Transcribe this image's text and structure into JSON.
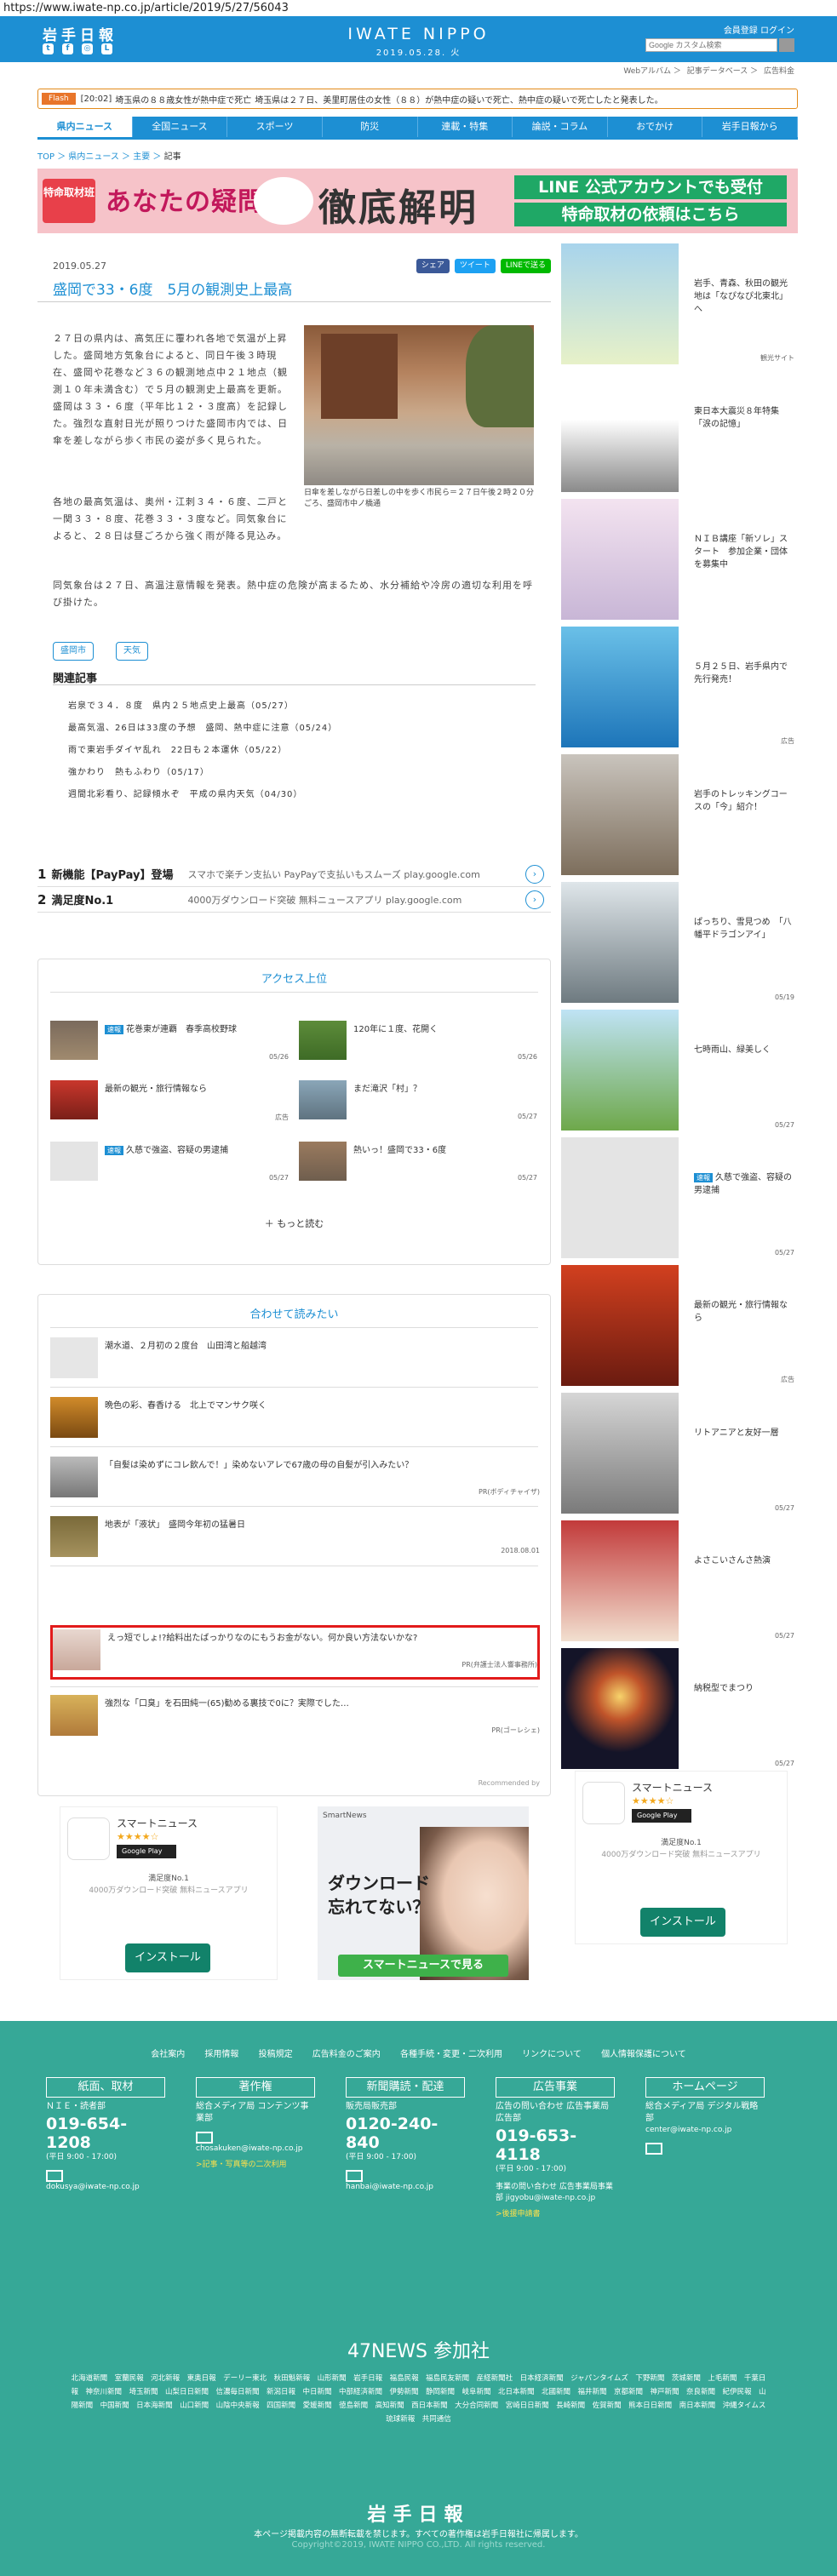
{
  "browser": {
    "url": "https://www.iwate-np.co.jp/article/2019/5/27/56043"
  },
  "header": {
    "logo_jp": "岩手日報",
    "logo_en": "IWATE NIPPO",
    "date": "2019.05.28. 火",
    "member_links": "会員登録 ログイン",
    "search_placeholder": "Google カスタム検索",
    "subnav": [
      "Webアルバム",
      "記事データベース",
      "広告料金"
    ]
  },
  "flash": {
    "tag": "Flash",
    "time": "[20:02]",
    "headline": "埼玉県の８８歳女性が熱中症で死亡",
    "text": "埼玉県は２７日、美里町居住の女性（８８）が熱中症の疑いで死亡、熱中症の疑いで死亡したと発表した。"
  },
  "gnav": [
    "県内ニュース",
    "全国ニュース",
    "スポーツ",
    "防災",
    "連載・特集",
    "論説・コラム",
    "おでかけ",
    "岩手日報から"
  ],
  "breadcrumb": {
    "top": "TOP",
    "cat": "県内ニュース",
    "sub": "主要",
    "current": "記事"
  },
  "banner": {
    "badge": "特命取材班",
    "lead": "あなたの疑問",
    "main": "徹底解明",
    "line1": "LINE 公式アカウントでも受付",
    "line2": "特命取材の依頼はこちら"
  },
  "article": {
    "date": "2019.05.27",
    "share": [
      "シェア",
      "ツイート",
      "LINEで送る"
    ],
    "title": "盛岡で33・6度　5月の観測史上最高",
    "p1": "２７日の県内は、高気圧に覆われ各地で気温が上昇した。盛岡地方気象台によると、同日午後３時現在、盛岡や花巻など３６の観測地点中２１地点（観測１０年未満含む）で５月の観測史上最高を更新。盛岡は３３・６度（平年比１２・３度高）を記録した。強烈な直射日光が照りつけた盛岡市内では、日傘を差しながら歩く市民の姿が多く見られた。",
    "p2": "各地の最高気温は、奥州・江刺３４・６度、二戸と一関３３・８度、花巻３３・３度など。同気象台によると、２８日は昼ごろから強く雨が降る見込み。",
    "p3": "同気象台は２７日、高温注意情報を発表。熱中症の危険が高まるため、水分補給や冷房の適切な利用を呼び掛けた。",
    "caption": "日傘を差しながら日差しの中を歩く市民ら＝２７日午後２時２０分ごろ、盛岡市中ノ橋通",
    "tags": [
      "盛岡市",
      "天気"
    ],
    "related_heading": "関連記事",
    "related": [
      "岩泉で３４．８度　県内２５地点史上最高（05/27）",
      "最高気温、26日は33度の予想　盛岡、熱中症に注意（05/24）",
      "雨で東岩手ダイヤ乱れ　22日も２本運休（05/22）",
      "強かわり　熱もふわり（05/17）",
      "週間北彩看り、記録傾水ぞ　平成の県内天気（04/30）"
    ]
  },
  "sponsored": [
    {
      "num": "1",
      "title": "新機能【PayPay】登場",
      "desc": "スマホで楽チン支払い PayPayで支払いもスムーズ play.google.com"
    },
    {
      "num": "2",
      "title": "満足度No.1",
      "desc": "4000万ダウンロード突破 無料ニュースアプリ play.google.com"
    }
  ],
  "access": {
    "heading": "アクセス上位",
    "items": [
      {
        "badge": "速報",
        "text": "花巻東が連覇　春季高校野球",
        "meta": "05/26"
      },
      {
        "badge": "",
        "text": "120年に１度、花開く",
        "meta": "05/26"
      },
      {
        "badge": "",
        "text": "最新の観光・旅行情報なら",
        "meta": "広告"
      },
      {
        "badge": "",
        "text": "まだ滝沢「村」？",
        "meta": "05/27"
      },
      {
        "badge": "速報",
        "text": "久慈で強盗、容疑の男逮捕",
        "meta": "05/27"
      },
      {
        "badge": "",
        "text": "熱いっ！盛岡で33・6度",
        "meta": "05/27"
      }
    ],
    "more": "もっと読む"
  },
  "recommend": {
    "heading": "合わせて読みたい",
    "items": [
      {
        "text": "潮水道、２月初の２度台　山田湾と船越湾",
        "meta": ""
      },
      {
        "text": "晩色の彩、春香ける　北上でマンサク咲く",
        "meta": ""
      },
      {
        "text": "「自髪は染めずにコレ飲んで！」染めないアレで67歳の母の自髪が引入みたい？",
        "meta": "PR(ボディチャイザ)"
      },
      {
        "text": "地表が「液状」　盛岡今年初の猛暑日",
        "meta": "2018.08.01"
      },
      {
        "text": "えっ短でしょ!?給料出たばっかりなのにもうお金がない。何か良い方法ないかな?",
        "meta": "PR(弁護士法人響事務所)"
      },
      {
        "text": "強烈な「口臭」を石田純一(65)勧める裏技で0に？実際でした…",
        "meta": "PR(ゴーレシェ)"
      }
    ],
    "recommended_by": "Recommended by"
  },
  "smartnews_ad": {
    "name": "スマートニュース",
    "stars": "★★★★☆",
    "gp": "Google Play",
    "rate": "満足度No.1",
    "desc": "4000万ダウンロード突破 無料ニュースアプリ",
    "install": "インストール"
  },
  "image_ad": {
    "brand": "SmartNews",
    "line1": "ダウンロード",
    "line2": "忘れてない？",
    "cta": "スマートニュースで見る"
  },
  "sidebar": [
    {
      "text": "岩手、青森、秋田の観光地は「なぴなぴ北東北」へ",
      "meta": "観光サイト"
    },
    {
      "text": "東日本大震災８年特集「涙の記憶」",
      "meta": ""
    },
    {
      "text": "ＮＩＢ講座「新ソレ」スタート　参加企業・団体を募集中",
      "meta": ""
    },
    {
      "text": "５月２５日、岩手県内で先行発売！",
      "meta": "広告"
    },
    {
      "text": "岩手のトレッキングコースの「今」紹介！",
      "meta": ""
    },
    {
      "text": "ぱっちり、雪見つめ　「八幡平ドラゴンアイ」",
      "meta": "05/19"
    },
    {
      "text": "七時雨山、緑美しく",
      "meta": "05/27"
    },
    {
      "text": "久慈で強盗、容疑の男逮捕",
      "badge": "速報",
      "meta": "05/27"
    },
    {
      "text": "最新の観光・旅行情報なら",
      "meta": "広告"
    },
    {
      "text": "リトアニアと友好一層",
      "meta": "05/27"
    },
    {
      "text": "よさこいさんさ熱演",
      "meta": "05/27"
    },
    {
      "text": "納税型でまつり",
      "meta": "05/27"
    }
  ],
  "footer": {
    "links": [
      "会社案内",
      "採用情報",
      "投稿規定",
      "広告料金のご案内",
      "各種手続・変更・二次利用",
      "リンクについて",
      "個人情報保護について"
    ],
    "cols": [
      {
        "head": "紙面、取材",
        "label": "ＮＩＥ・読者部",
        "phone": "019-654-1208",
        "hours": "(平日 9:00 - 17:00)",
        "email": "dokusya@iwate-np.co.jp",
        "extra": ""
      },
      {
        "head": "著作権",
        "label": "総合メディア局 コンテンツ事業部",
        "phone": "",
        "hours": "",
        "email": "chosakuken@iwate-np.co.jp",
        "extra": ">記事・写真等の二次利用"
      },
      {
        "head": "新聞購読・配達",
        "label": "販売局販売部",
        "phone": "0120-240-840",
        "hours": "(平日 9:00 - 17:00)",
        "email": "hanbai@iwate-np.co.jp",
        "extra": ""
      },
      {
        "head": "広告事業",
        "label": "広告の問い合わせ 広告事業局広告部",
        "phone": "019-653-4118",
        "hours": "(平日 9:00 - 17:00)",
        "email": "事業の問い合わせ 広告事業局事業部 jigyobu@iwate-np.co.jp",
        "extra": ">後援申請書"
      },
      {
        "head": "ホームページ",
        "label": "総合メディア局 デジタル戦略部",
        "phone": "",
        "hours": "",
        "email": "center@iwate-np.co.jp",
        "extra": ""
      }
    ],
    "n47_heading": "47NEWS 参加社",
    "n47_list": "北海道新聞　室蘭民報　河北新報　東奥日報　デーリー東北　秋田魁新報　山形新聞　岩手日報　福島民報　福島民友新聞　産経新聞社　日本経済新聞　ジャパンタイムズ　下野新聞　茨城新聞　上毛新聞　千葉日報　神奈川新聞　埼玉新聞　山梨日日新聞　信濃毎日新聞　新潟日報　中日新聞　中部経済新聞　伊勢新聞　静岡新聞　岐阜新聞　北日本新聞　北國新聞　福井新聞　京都新聞　神戸新聞　奈良新聞　紀伊民報　山陽新聞　中国新聞　日本海新聞　山口新聞　山陰中央新報　四国新聞　愛媛新聞　徳島新聞　高知新聞　西日本新聞　大分合同新聞　宮崎日日新聞　長崎新聞　佐賀新聞　熊本日日新聞　南日本新聞　沖縄タイムス　琉球新報　共同通信",
    "logo": "岩手日報",
    "copy1": "本ページ掲載内容の無断転載を禁じます。すべての著作権は岩手日報社に帰属します。",
    "copy2": "Copyright©2019, IWATE NIPPO CO.,LTD. All rights reserved."
  }
}
